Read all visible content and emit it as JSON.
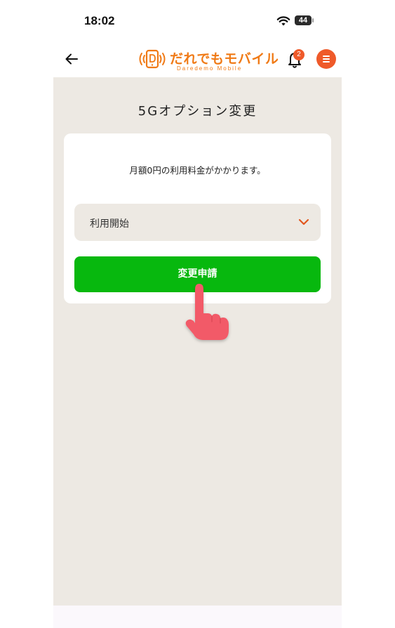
{
  "status_bar": {
    "time": "18:02",
    "battery": "44",
    "wifi_icon": "wifi-icon",
    "battery_icon": "battery-icon"
  },
  "header": {
    "back_icon": "arrow-left-icon",
    "logo": {
      "text": "だれでもモバイル",
      "subtext": "Daredemo Mobile"
    },
    "notifications": {
      "icon": "bell-icon",
      "badge_count": "2"
    },
    "menu_icon": "hamburger-menu-icon"
  },
  "main": {
    "title": "5Gオプション変更",
    "notice": "月額0円の利用料金がかかります。",
    "select": {
      "value": "利用開始",
      "icon": "chevron-down-icon"
    },
    "submit_label": "変更申請"
  },
  "overlay": {
    "icon": "hand-pointer-icon"
  },
  "colors": {
    "brand_orange": "#f07a16",
    "badge_red": "#ef5a2a",
    "button_green": "#07b80e",
    "background_beige": "#ede9e3",
    "pointer_pink": "#f25a68"
  }
}
